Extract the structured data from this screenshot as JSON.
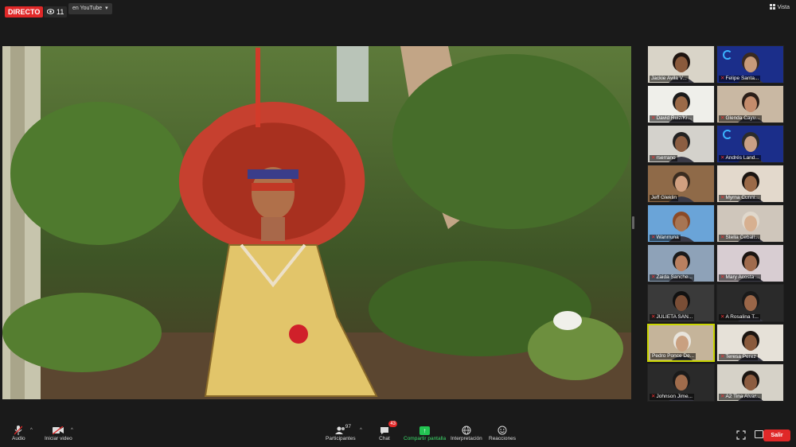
{
  "topbar": {
    "live_label": "DIRECTO",
    "viewer_count": "11",
    "youtube_label": "en YouTube",
    "view_label": "Vista"
  },
  "gallery": [
    {
      "name": "Jackie Avila V...",
      "muted": false,
      "bg": "#d9d4c8",
      "skin": "#8a5a3c",
      "hair": "#1e1410"
    },
    {
      "name": "Felipe Santa...",
      "muted": true,
      "bg": "#1b2e8a",
      "skin": "#c79a7a",
      "hair": "#3a2a20",
      "loader": true
    },
    {
      "name": "David Ruiz/Ki...",
      "muted": true,
      "bg": "#efefea",
      "skin": "#9b6a48",
      "hair": "#1a1a1a"
    },
    {
      "name": "Glenda Cayu...",
      "muted": true,
      "bg": "#c9b8a3",
      "skin": "#c48c6c",
      "hair": "#2a1e18"
    },
    {
      "name": "rserrano",
      "muted": true,
      "bg": "#d4d2cc",
      "skin": "#8c5e42",
      "hair": "#222"
    },
    {
      "name": "Andrés Land...",
      "muted": true,
      "bg": "#1b2e8a",
      "skin": "#c9a085",
      "hair": "#2c2c2c",
      "loader": true
    },
    {
      "name": "Jeff Gleklin",
      "muted": false,
      "bg": "#8f6a48",
      "skin": "#d1a080",
      "hair": "#3a2c20"
    },
    {
      "name": "Myrna Cunni...",
      "muted": true,
      "bg": "#e3d9cc",
      "skin": "#9b6a48",
      "hair": "#1a1410"
    },
    {
      "name": "Wanrruna",
      "muted": true,
      "bg": "#6aa4d8",
      "skin": "#a77553",
      "hair": "#8b4a26"
    },
    {
      "name": "Stella Ceball...",
      "muted": true,
      "bg": "#cfc6bb",
      "skin": "#d7b090",
      "hair": "#e0d8cc"
    },
    {
      "name": "Zaida Sanche...",
      "muted": true,
      "bg": "#8ea2b8",
      "skin": "#b98060",
      "hair": "#1a1a1a"
    },
    {
      "name": "Mary Acosta ...",
      "muted": true,
      "bg": "#d8cdd2",
      "skin": "#a06b4d",
      "hair": "#1a1410"
    },
    {
      "name": "JULIETA SAN...",
      "muted": true,
      "bg": "#3a3a3a",
      "skin": "#7a4e36",
      "hair": "#111"
    },
    {
      "name": "A Rosalina T...",
      "muted": true,
      "bg": "#2a2a2a",
      "skin": "#9a6648",
      "hair": "#1a1a1a"
    },
    {
      "name": "Pedro Ponce De...",
      "muted": false,
      "bg": "#c5b49a",
      "skin": "#c9a080",
      "hair": "#e8e4dc",
      "active": true
    },
    {
      "name": "Teresa Perez",
      "muted": true,
      "bg": "#e6e1d8",
      "skin": "#8a5a3c",
      "hair": "#1a1410"
    },
    {
      "name": "Johnson Jime...",
      "muted": true,
      "bg": "#2a2a2a",
      "skin": "#a06c4c",
      "hair": "#1a1a1a"
    },
    {
      "name": "A2 Tina Alvar...",
      "muted": true,
      "bg": "#d6d2c8",
      "skin": "#8c5c40",
      "hair": "#1a1410"
    }
  ],
  "toolbar": {
    "audio_label": "Audio",
    "video_label": "Iniciar video",
    "participants_label": "Participantes",
    "participants_count": "97",
    "chat_label": "Chat",
    "chat_badge": "43",
    "share_label": "Compartir pantalla",
    "interpretation_label": "Interpretación",
    "reactions_label": "Reacciones",
    "exit_label": "Salir"
  },
  "colors": {
    "live_red": "#e02828",
    "share_green": "#23c552",
    "active_speaker_border": "#c8d400"
  },
  "icons": [
    "eye-icon",
    "grid-icon",
    "mic-muted-icon",
    "video-off-icon",
    "participants-icon",
    "chat-icon",
    "share-screen-icon",
    "globe-icon",
    "reaction-icon",
    "fullscreen-icon",
    "pip-icon"
  ]
}
